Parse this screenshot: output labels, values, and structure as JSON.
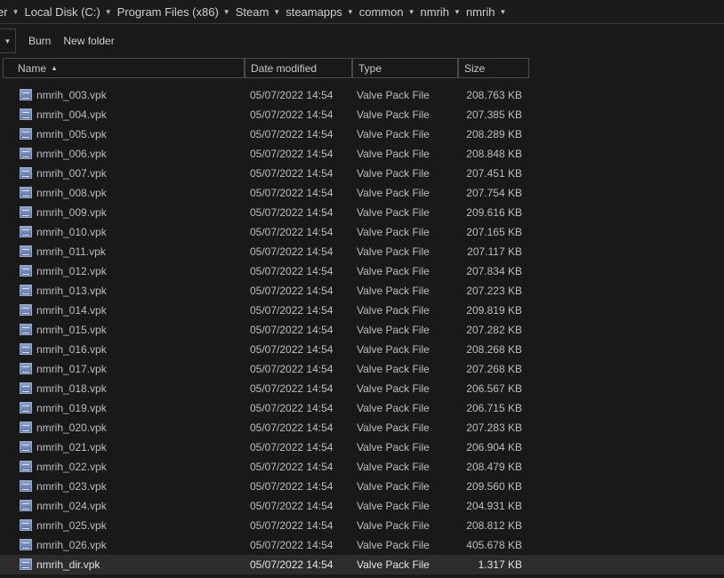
{
  "breadcrumb": [
    "er",
    "Local Disk (C:)",
    "Program Files (x86)",
    "Steam",
    "steamapps",
    "common",
    "nmrih",
    "nmrih"
  ],
  "toolbar": {
    "burn_label": "Burn",
    "new_folder_label": "New folder"
  },
  "columns": {
    "name": "Name",
    "date": "Date modified",
    "type": "Type",
    "size": "Size"
  },
  "files": [
    {
      "name": "nmrih_003.vpk",
      "date": "05/07/2022 14:54",
      "type": "Valve Pack File",
      "size": "208.763 KB"
    },
    {
      "name": "nmrih_004.vpk",
      "date": "05/07/2022 14:54",
      "type": "Valve Pack File",
      "size": "207.385 KB"
    },
    {
      "name": "nmrih_005.vpk",
      "date": "05/07/2022 14:54",
      "type": "Valve Pack File",
      "size": "208.289 KB"
    },
    {
      "name": "nmrih_006.vpk",
      "date": "05/07/2022 14:54",
      "type": "Valve Pack File",
      "size": "208.848 KB"
    },
    {
      "name": "nmrih_007.vpk",
      "date": "05/07/2022 14:54",
      "type": "Valve Pack File",
      "size": "207.451 KB"
    },
    {
      "name": "nmrih_008.vpk",
      "date": "05/07/2022 14:54",
      "type": "Valve Pack File",
      "size": "207.754 KB"
    },
    {
      "name": "nmrih_009.vpk",
      "date": "05/07/2022 14:54",
      "type": "Valve Pack File",
      "size": "209.616 KB"
    },
    {
      "name": "nmrih_010.vpk",
      "date": "05/07/2022 14:54",
      "type": "Valve Pack File",
      "size": "207.165 KB"
    },
    {
      "name": "nmrih_011.vpk",
      "date": "05/07/2022 14:54",
      "type": "Valve Pack File",
      "size": "207.117 KB"
    },
    {
      "name": "nmrih_012.vpk",
      "date": "05/07/2022 14:54",
      "type": "Valve Pack File",
      "size": "207.834 KB"
    },
    {
      "name": "nmrih_013.vpk",
      "date": "05/07/2022 14:54",
      "type": "Valve Pack File",
      "size": "207.223 KB"
    },
    {
      "name": "nmrih_014.vpk",
      "date": "05/07/2022 14:54",
      "type": "Valve Pack File",
      "size": "209.819 KB"
    },
    {
      "name": "nmrih_015.vpk",
      "date": "05/07/2022 14:54",
      "type": "Valve Pack File",
      "size": "207.282 KB"
    },
    {
      "name": "nmrih_016.vpk",
      "date": "05/07/2022 14:54",
      "type": "Valve Pack File",
      "size": "208.268 KB"
    },
    {
      "name": "nmrih_017.vpk",
      "date": "05/07/2022 14:54",
      "type": "Valve Pack File",
      "size": "207.268 KB"
    },
    {
      "name": "nmrih_018.vpk",
      "date": "05/07/2022 14:54",
      "type": "Valve Pack File",
      "size": "206.567 KB"
    },
    {
      "name": "nmrih_019.vpk",
      "date": "05/07/2022 14:54",
      "type": "Valve Pack File",
      "size": "206.715 KB"
    },
    {
      "name": "nmrih_020.vpk",
      "date": "05/07/2022 14:54",
      "type": "Valve Pack File",
      "size": "207.283 KB"
    },
    {
      "name": "nmrih_021.vpk",
      "date": "05/07/2022 14:54",
      "type": "Valve Pack File",
      "size": "206.904 KB"
    },
    {
      "name": "nmrih_022.vpk",
      "date": "05/07/2022 14:54",
      "type": "Valve Pack File",
      "size": "208.479 KB"
    },
    {
      "name": "nmrih_023.vpk",
      "date": "05/07/2022 14:54",
      "type": "Valve Pack File",
      "size": "209.560 KB"
    },
    {
      "name": "nmrih_024.vpk",
      "date": "05/07/2022 14:54",
      "type": "Valve Pack File",
      "size": "204.931 KB"
    },
    {
      "name": "nmrih_025.vpk",
      "date": "05/07/2022 14:54",
      "type": "Valve Pack File",
      "size": "208.812 KB"
    },
    {
      "name": "nmrih_026.vpk",
      "date": "05/07/2022 14:54",
      "type": "Valve Pack File",
      "size": "405.678 KB"
    },
    {
      "name": "nmrih_dir.vpk",
      "date": "05/07/2022 14:54",
      "type": "Valve Pack File",
      "size": "1.317 KB",
      "selected": true
    }
  ]
}
